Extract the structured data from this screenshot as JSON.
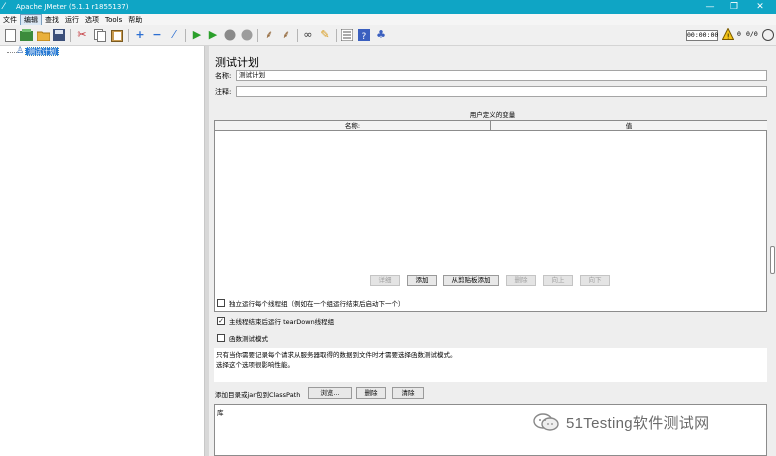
{
  "window": {
    "title": "Apache JMeter (5.1.1 r1855137)",
    "controls": {
      "minimize": "—",
      "restore": "❐",
      "close": "✕"
    }
  },
  "menubar": {
    "items": [
      "文件",
      "编辑",
      "查找",
      "运行",
      "选项",
      "Tools",
      "帮助"
    ],
    "active_index": 1
  },
  "toolbar": {
    "timer": "00:00:00",
    "error_count": "0",
    "thread_count": "0/0"
  },
  "tree": {
    "root_label": "测试计划"
  },
  "test_plan": {
    "title": "测试计划",
    "name_label": "名称:",
    "name_value": "测试计划",
    "comment_label": "注释:",
    "comment_value": "",
    "variables_title": "用户定义的变量",
    "columns": [
      "名称:",
      "值"
    ],
    "buttons": {
      "detail": "详细",
      "add": "添加",
      "add_from_clipboard": "从剪贴板添加",
      "delete": "删除",
      "up": "向上",
      "down": "向下"
    },
    "checkboxes": [
      {
        "label": "独立运行每个线程组（例如在一个组运行结束后启动下一个）",
        "checked": false
      },
      {
        "label": "主线程结束后运行 tearDown线程组",
        "checked": true
      },
      {
        "label": "函数测试模式",
        "checked": false
      }
    ],
    "description_line1": "只有当你需要记录每个请求从服务器取得的数据到文件时才需要选择函数测试模式。",
    "description_line2": "选择这个选项很影响性能。",
    "classpath_label": "添加目录或jar包到ClassPath",
    "classpath_buttons": {
      "browse": "浏览...",
      "delete": "删除",
      "clear": "清除"
    },
    "library_header": "库"
  },
  "watermark": {
    "text": "51Testing软件测试网"
  },
  "colors": {
    "titlebar": "#0fa5c5",
    "selection": "#2a7bd4"
  }
}
